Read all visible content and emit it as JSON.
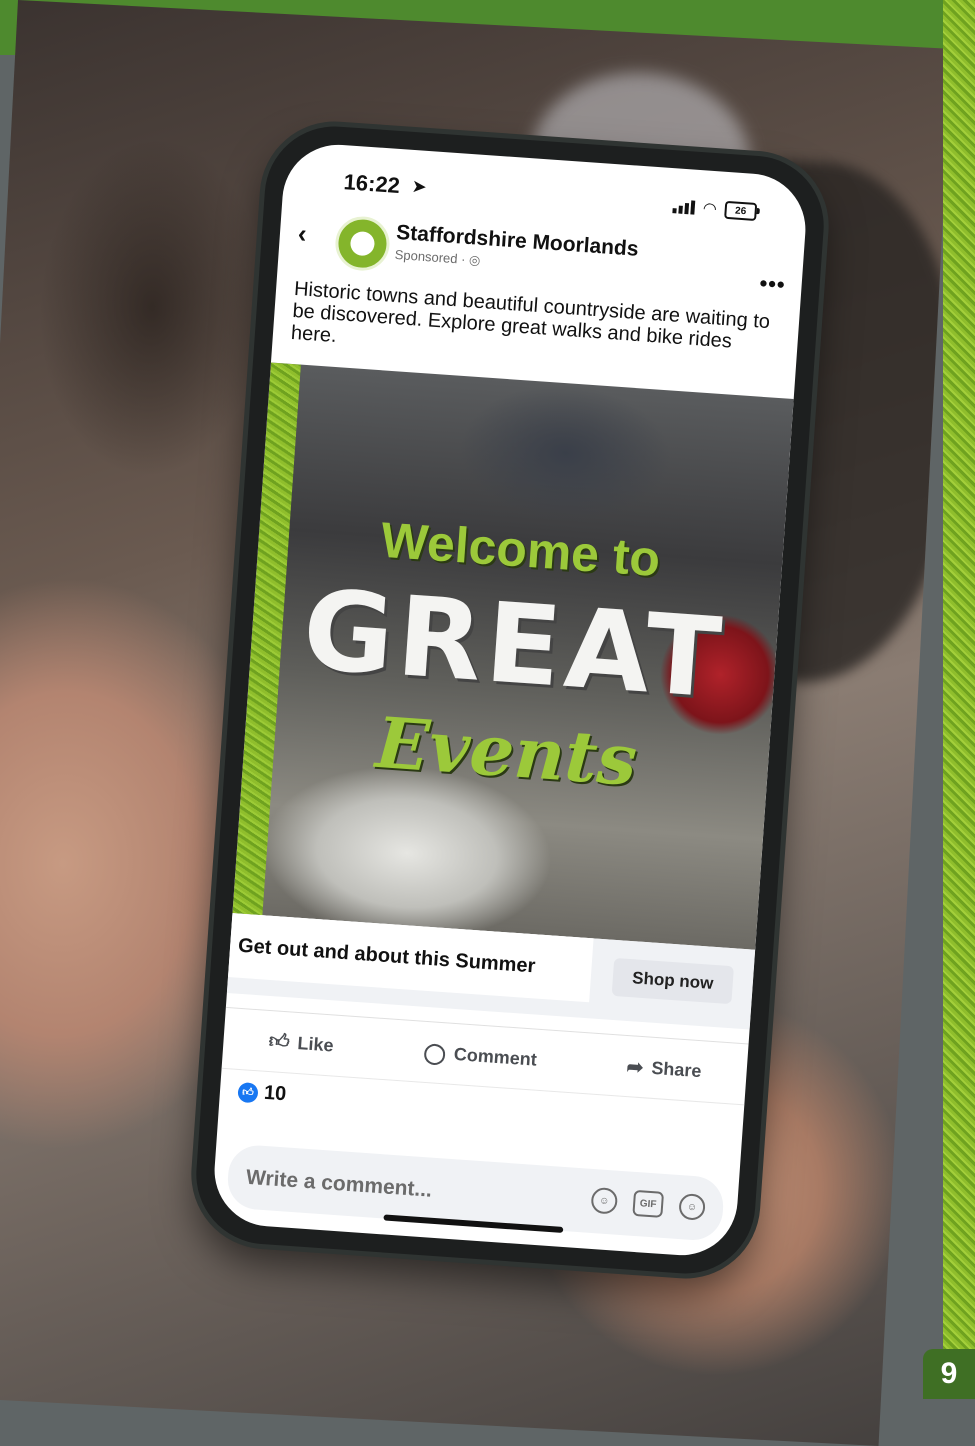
{
  "status_bar": {
    "time": "16:22",
    "battery": "26"
  },
  "post": {
    "page_name": "Staffordshire Moorlands",
    "sponsored_label": "Sponsored · ",
    "text": "Historic towns and beautiful countryside are waiting to be discovered. Explore great walks and bike rides here.",
    "image": {
      "line1": "Welcome to",
      "line2": "GREAT",
      "line3": "Events"
    },
    "cta": {
      "headline": "Get out and about this Summer",
      "button": "Shop now"
    },
    "actions": {
      "like": "Like",
      "comment": "Comment",
      "share": "Share"
    },
    "reaction_count": "10",
    "comment_placeholder": "Write a comment...",
    "comment_icons": {
      "gif": "GIF"
    }
  },
  "page_number": "9",
  "colors": {
    "brand_green": "#4e8a2e",
    "accent_lime": "#9cc93a",
    "facebook_blue": "#1877f2"
  },
  "icons": [
    "back-icon",
    "more-icon",
    "like-icon",
    "comment-icon",
    "share-icon",
    "sticker-icon",
    "gif-icon",
    "emoji-icon",
    "signal-icon",
    "wifi-icon",
    "battery-icon"
  ]
}
